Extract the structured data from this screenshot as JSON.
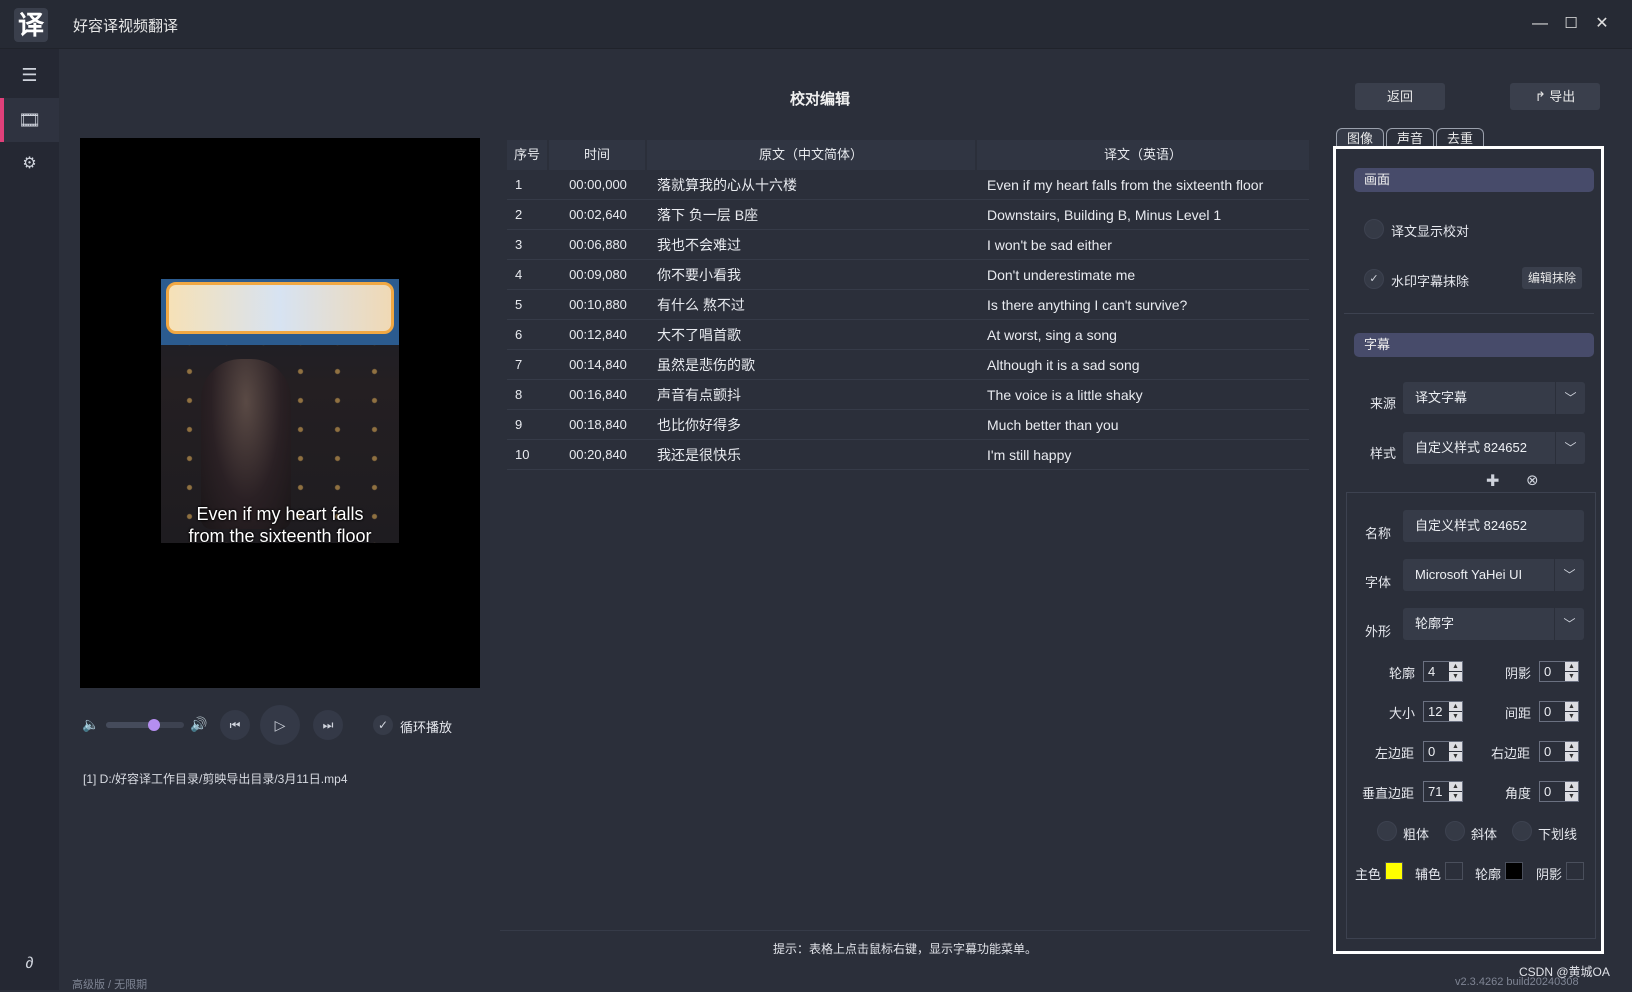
{
  "window": {
    "logo_char": "译",
    "title": "好容译视频翻译",
    "minimize": "—",
    "maximize": "☐",
    "close": "✕"
  },
  "sidebar": {
    "items": [
      {
        "icon": "menu-icon",
        "glyph": "☰"
      },
      {
        "icon": "film-icon",
        "glyph": "🎞"
      },
      {
        "icon": "gear-icon",
        "glyph": "⚙"
      }
    ],
    "bottom_glyph": "∂"
  },
  "header": {
    "title": "校对编辑",
    "back_label": "返回",
    "export_label": "导出",
    "export_glyph": "↱"
  },
  "video": {
    "subtitle_line1": "Even if my heart falls",
    "subtitle_line2": "from the sixteenth floor"
  },
  "player": {
    "volume_level": 0.62,
    "loop_label": "循环播放",
    "loop_checked": true
  },
  "file_path": "[1] D:/好容译工作目录/剪映导出目录/3月11日.mp4",
  "table": {
    "headers": [
      "序号",
      "时间",
      "原文（中文简体）",
      "译文（英语）"
    ],
    "rows": [
      [
        "1",
        "00:00,000",
        "落就算我的心从十六楼",
        "Even if my heart falls from the sixteenth floor"
      ],
      [
        "2",
        "00:02,640",
        "落下 负一层 B座",
        "Downstairs, Building B, Minus Level 1"
      ],
      [
        "3",
        "00:06,880",
        "我也不会难过",
        "I won't be sad either"
      ],
      [
        "4",
        "00:09,080",
        "你不要小看我",
        "Don't underestimate me"
      ],
      [
        "5",
        "00:10,880",
        "有什么 熬不过",
        "Is there anything I can't survive?"
      ],
      [
        "6",
        "00:12,840",
        "大不了唱首歌",
        "At worst, sing a song"
      ],
      [
        "7",
        "00:14,840",
        "虽然是悲伤的歌",
        "Although it is a sad song"
      ],
      [
        "8",
        "00:16,840",
        "声音有点颤抖",
        "The voice is a little shaky"
      ],
      [
        "9",
        "00:18,840",
        "也比你好得多",
        "Much better than you"
      ],
      [
        "10",
        "00:20,840",
        "我还是很快乐",
        "I'm still happy"
      ]
    ]
  },
  "hint": "提示：表格上点击鼠标右键，显示字幕功能菜单。",
  "panel": {
    "tabs": [
      "图像",
      "声音",
      "去重"
    ],
    "section_picture": "画面",
    "show_translation_proof": "译文显示校对",
    "watermark_remove": "水印字幕抹除",
    "watermark_checked": true,
    "edit_remove_button": "编辑抹除",
    "section_subtitle": "字幕",
    "source_label": "来源",
    "source_value": "译文字幕",
    "style_label": "样式",
    "style_value": "自定义样式 824652",
    "name_label": "名称",
    "name_value": "自定义样式 824652",
    "font_label": "字体",
    "font_value": "Microsoft YaHei UI",
    "shape_label": "外形",
    "shape_value": "轮廓字",
    "outline_label": "轮廓",
    "outline_value": "4",
    "shadow_label": "阴影",
    "shadow_value": "0",
    "size_label": "大小",
    "size_value": "12",
    "spacing_label": "间距",
    "spacing_value": "0",
    "left_margin_label": "左边距",
    "left_margin_value": "0",
    "right_margin_label": "右边距",
    "right_margin_value": "0",
    "vertical_margin_label": "垂直边距",
    "vertical_margin_value": "71",
    "angle_label": "角度",
    "angle_value": "0",
    "bold_label": "粗体",
    "italic_label": "斜体",
    "underline_label": "下划线",
    "primary_color_label": "主色",
    "secondary_color_label": "辅色",
    "outline_color_label": "轮廓",
    "shadow_color_label": "阴影",
    "colors": {
      "primary": "#ffff00",
      "secondary": "#2b2f3a",
      "outline": "#000000",
      "shadow": "#2b2f3a"
    }
  },
  "footer": {
    "edition": "高级版 / 无限期",
    "version": "v2.3.4262 build20240308",
    "watermark": "CSDN @黄城OA"
  }
}
